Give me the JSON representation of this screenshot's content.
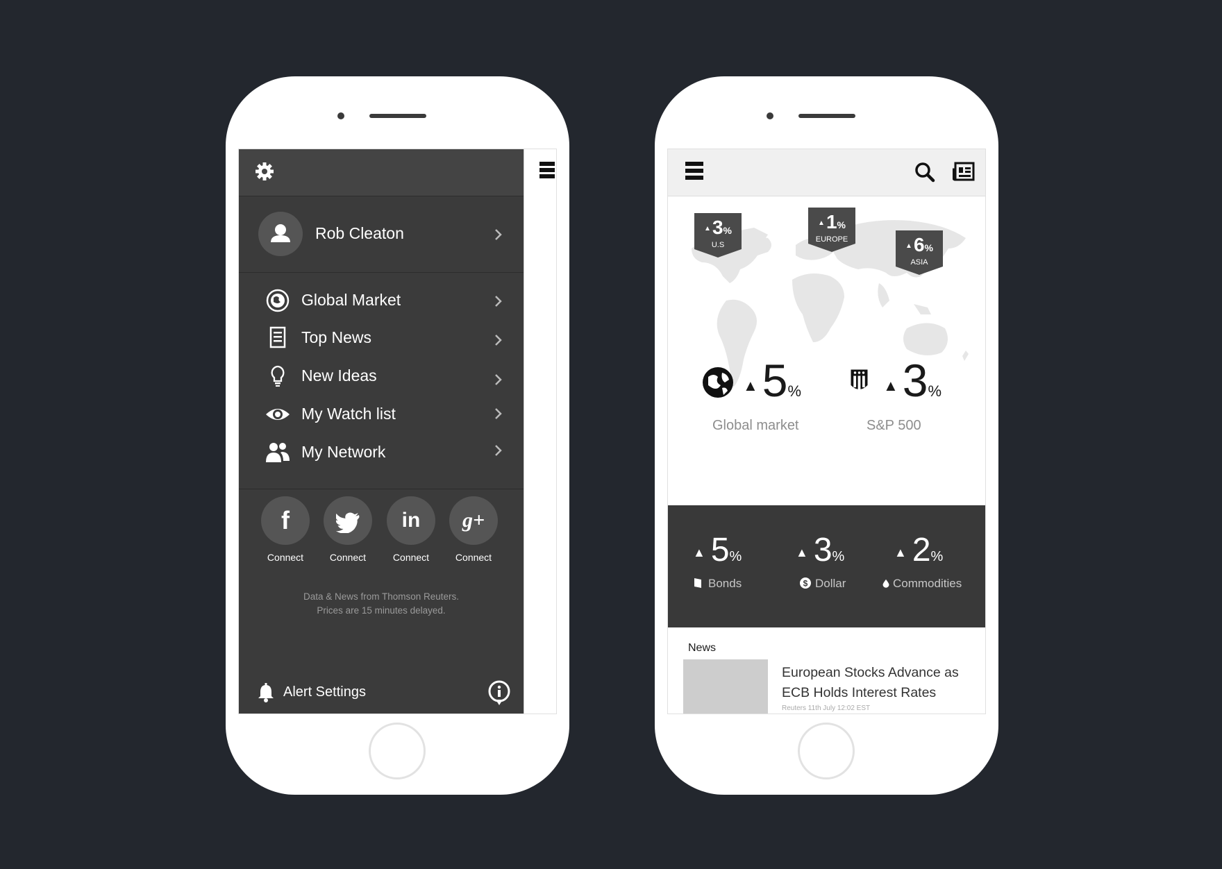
{
  "left_phone": {
    "user_name": "Rob Cleaton",
    "menu": [
      {
        "label": "Global Market",
        "icon": "globe-icon"
      },
      {
        "label": "Top News",
        "icon": "document-icon"
      },
      {
        "label": "New Ideas",
        "icon": "lightbulb-icon"
      },
      {
        "label": "My Watch list",
        "icon": "eye-icon"
      },
      {
        "label": "My Network",
        "icon": "people-icon"
      }
    ],
    "socials": [
      {
        "glyph": "f",
        "label": "Connect",
        "icon": "facebook-icon"
      },
      {
        "glyph": "🐦",
        "label": "Connect",
        "icon": "twitter-icon"
      },
      {
        "glyph": "in",
        "label": "Connect",
        "icon": "linkedin-icon"
      },
      {
        "glyph": "g+",
        "label": "Connect",
        "icon": "google-plus-icon"
      }
    ],
    "disclaimer_line1": "Data & News from Thomson Reuters.",
    "disclaimer_line2": "Prices are 15 minutes delayed.",
    "alert_label": "Alert Settings"
  },
  "right_phone": {
    "region_tags": [
      {
        "value": "3",
        "unit": "%",
        "region": "U.S"
      },
      {
        "value": "1",
        "unit": "%",
        "region": "EUROPE"
      },
      {
        "value": "6",
        "unit": "%",
        "region": "ASIA"
      }
    ],
    "global_market": {
      "value": "5",
      "unit": "%",
      "label": "Global market"
    },
    "sp500": {
      "value": "3",
      "unit": "%",
      "label": "S&P 500"
    },
    "bonds": {
      "value": "5",
      "unit": "%",
      "label": "Bonds"
    },
    "dollar": {
      "value": "3",
      "unit": "%",
      "label": "Dollar"
    },
    "commodities": {
      "value": "2",
      "unit": "%",
      "label": "Commodities"
    },
    "news": {
      "section_label": "News",
      "headline": "European Stocks Advance as ECB Holds Interest Rates",
      "meta": "Reuters 11th July 12:02 EST"
    }
  },
  "colors": {
    "background": "#23272e",
    "drawer": "#3b3b3b",
    "band": "#393939",
    "map": "#e6e6e6"
  }
}
